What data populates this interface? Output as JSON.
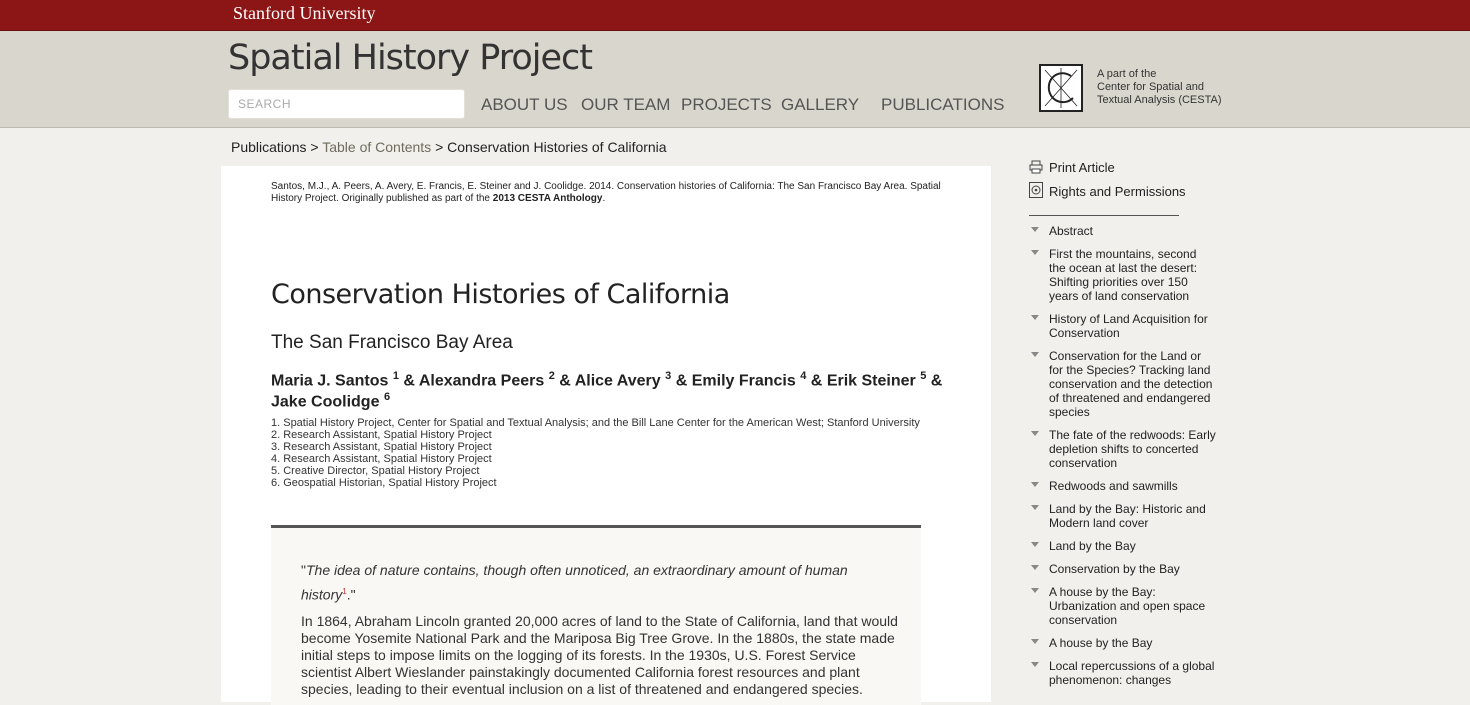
{
  "topbar": {
    "brand": "Stanford University"
  },
  "header": {
    "site_title": "Spatial History Project",
    "search_placeholder": "SEARCH",
    "nav": [
      "ABOUT US",
      "OUR TEAM",
      "PROJECTS",
      "GALLERY",
      "PUBLICATIONS"
    ],
    "cesta_line1": "A part of the",
    "cesta_line2": "Center for Spatial and",
    "cesta_line3": "Textual Analysis (CESTA)"
  },
  "breadcrumb": {
    "item1": "Publications",
    "sep": ">",
    "item2": "Table of Contents",
    "item3": "Conservation Histories of California"
  },
  "article": {
    "citation_text": "Santos, M.J., A. Peers, A. Avery, E. Francis, E. Steiner and J. Coolidge. 2014. Conservation histories of California: The San Francisco Bay Area. Spatial History Project. Originally published as part of the ",
    "citation_bold": "2013 CESTA Anthology",
    "citation_end": ".",
    "title": "Conservation Histories of California",
    "subtitle": "The San Francisco Bay Area",
    "authors": [
      {
        "name": "Maria J. Santos",
        "num": "1"
      },
      {
        "name": "Alexandra Peers",
        "num": "2"
      },
      {
        "name": "Alice Avery",
        "num": "3"
      },
      {
        "name": "Emily Francis",
        "num": "4"
      },
      {
        "name": "Erik Steiner",
        "num": "5"
      },
      {
        "name": "Jake Coolidge",
        "num": "6"
      }
    ],
    "author_sep": "&",
    "affiliations": [
      "1. Spatial History Project, Center for Spatial and Textual Analysis; and the Bill Lane Center for the American West; Stanford University",
      "2. Research Assistant, Spatial History Project",
      "3. Research Assistant, Spatial History Project",
      "4. Research Assistant, Spatial History Project",
      "5. Creative Director, Spatial History Project",
      "6. Geospatial Historian, Spatial History Project"
    ],
    "quote_open": "\"",
    "quote_text": "The idea of nature contains, though often unnoticed, an extraordinary amount of human history",
    "quote_footnote": "1",
    "quote_close": ".\"",
    "paragraph": "In 1864, Abraham Lincoln granted 20,000 acres of land to the State of California, land that would become Yosemite National Park and the Mariposa Big Tree Grove. In the 1880s, the state made initial steps to impose limits on the logging of its forests. In the 1930s, U.S. Forest Service scientist Albert Wieslander painstakingly documented California forest resources and plant species, leading to their eventual inclusion on a list of threatened and endangered species."
  },
  "sidebar": {
    "print_label": "Print Article",
    "rights_label": "Rights and Permissions",
    "toc": [
      "Abstract",
      "First the mountains, second the ocean at last the desert: Shifting priorities over 150 years of land conservation",
      "History of Land Acquisition for Conservation",
      "Conservation for the Land or for the Species? Tracking land conservation and the detection of threatened and endangered species",
      "The fate of the redwoods: Early depletion shifts to concerted conservation",
      "Redwoods and sawmills",
      "Land by the Bay: Historic and Modern land cover",
      "Land by the Bay",
      "Conservation by the Bay",
      "A house by the Bay: Urbanization and open space conservation",
      "A house by the Bay",
      "Local repercussions of a global phenomenon: changes"
    ]
  },
  "colors": {
    "stanford_red": "#8c1515",
    "header_bg": "#d9d7cd",
    "page_bg": "#f1f0ed"
  }
}
